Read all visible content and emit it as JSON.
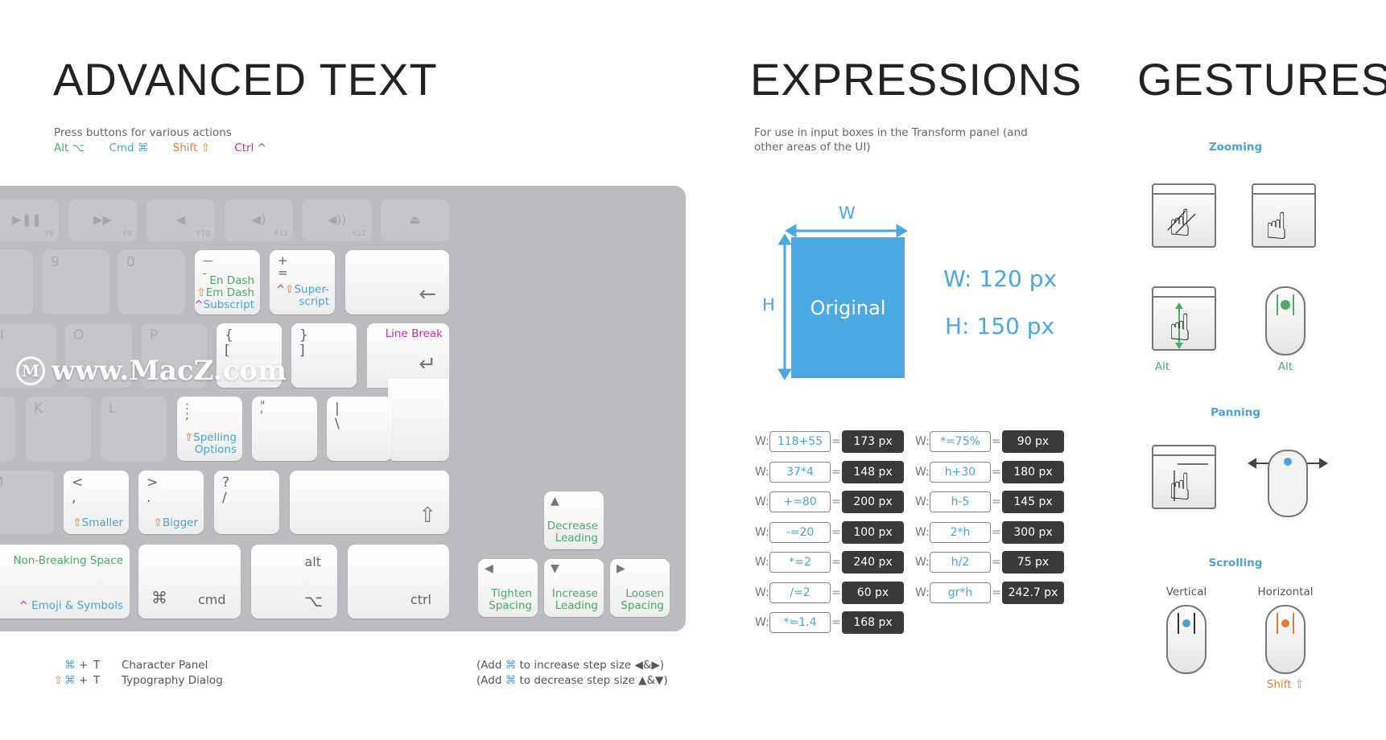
{
  "sections": {
    "advanced_text": {
      "title": "ADVANCED TEXT",
      "description": "Press buttons for various actions",
      "legend": {
        "alt": "Alt ⌥",
        "cmd": "Cmd ⌘",
        "shift": "Shift ⇧",
        "ctrl": "Ctrl ^"
      }
    },
    "expressions": {
      "title": "EXPRESSIONS",
      "description": "For use in input boxes in the Transform panel (and other areas of the UI)"
    },
    "gestures": {
      "title": "GESTURES"
    }
  },
  "keyboard": {
    "function_row": [
      {
        "icon": "play-pause-icon",
        "glyph": "▶❚❚",
        "fn": "F8"
      },
      {
        "icon": "fast-forward-icon",
        "glyph": "▶▶",
        "fn": "F9"
      },
      {
        "icon": "mute-icon",
        "glyph": "◀",
        "fn": "F10"
      },
      {
        "icon": "volume-down-icon",
        "glyph": "◀)",
        "fn": "F11"
      },
      {
        "icon": "volume-up-icon",
        "glyph": "◀))",
        "fn": "F12"
      },
      {
        "icon": "eject-icon",
        "glyph": "⏏",
        "fn": ""
      }
    ],
    "number_row": {
      "k9": "9",
      "k0": "0",
      "minus": {
        "top": "—",
        "base": "-",
        "a1": "En Dash",
        "a2_mod": "⇧",
        "a2": "Em Dash",
        "a3_mod": "^",
        "a3": "Subscript"
      },
      "equals": {
        "top": "+",
        "base": "=",
        "mod1": "^",
        "mod2": "⇧",
        "action": "Super-\nscript"
      },
      "backspace": "←"
    },
    "qwerty_row": {
      "i": "I",
      "o": "O",
      "p": "P",
      "lbracket": {
        "top": "{",
        "base": "["
      },
      "rbracket": {
        "top": "}",
        "base": "]"
      },
      "return": {
        "label": "Line Break",
        "glyph": "↵"
      }
    },
    "home_row": {
      "k": "K",
      "l": "L",
      "semicolon": {
        "top": ":",
        "base": ";",
        "mod": "⇧",
        "action": "Spelling\nOptions"
      },
      "quote": {
        "top": "\"",
        "base": "'"
      },
      "backslash": {
        "top": "|",
        "base": "\\"
      }
    },
    "bottom_row": {
      "m": "M",
      "comma": {
        "top": "<",
        "base": ",",
        "mod": "⇧",
        "action": "Smaller"
      },
      "period": {
        "top": ">",
        "base": ".",
        "mod": "⇧",
        "action": "Bigger"
      },
      "slash": {
        "top": "?",
        "base": "/"
      },
      "shift": "⇧"
    },
    "modifier_row": {
      "space": {
        "action": "Non-Breaking Space",
        "mod": "^",
        "action2": "Emoji & Symbols"
      },
      "cmd": {
        "glyph": "⌘",
        "label": "cmd"
      },
      "alt": {
        "label": "alt",
        "glyph": "⌥"
      },
      "ctrl": {
        "label": "ctrl"
      }
    },
    "arrows": {
      "up": {
        "glyph": "▲",
        "action": "Decrease\nLeading"
      },
      "left": {
        "glyph": "◀",
        "action": "Tighten\nSpacing"
      },
      "down": {
        "glyph": "▼",
        "action": "Increase\nLeading"
      },
      "right": {
        "glyph": "▶",
        "action": "Loosen\nSpacing"
      }
    }
  },
  "watermark": {
    "logo": "M",
    "text": "www.MacZ.com"
  },
  "shortcuts": [
    {
      "mods": "⌘",
      "plus": "+",
      "key": "T",
      "label": "Character Panel"
    },
    {
      "mods_shift": "⇧",
      "mods": "⌘",
      "plus": "+",
      "key": "T",
      "label": "Typography Dialog"
    }
  ],
  "step_notes": [
    {
      "pre": "(Add ",
      "mod": "⌘",
      "post": " to increase step size ◀&▶)"
    },
    {
      "pre": "(Add ",
      "mod": "⌘",
      "post": " to decrease step size ▲&▼)"
    }
  ],
  "transform_diagram": {
    "w_label": "W",
    "h_label": "H",
    "box_label": "Original",
    "width_readout": "W: 120 px",
    "height_readout": "H: 150 px"
  },
  "expressions_left": [
    {
      "field": "W:",
      "input": "118+55",
      "eq": "=",
      "result": "173 px"
    },
    {
      "field": "W:",
      "input": "37*4",
      "eq": "=",
      "result": "148 px"
    },
    {
      "field": "W:",
      "input": "+=80",
      "eq": "=",
      "result": "200 px"
    },
    {
      "field": "W:",
      "input": "-=20",
      "eq": "=",
      "result": "100 px"
    },
    {
      "field": "W:",
      "input": "*=2",
      "eq": "=",
      "result": "240 px"
    },
    {
      "field": "W:",
      "input": "/=2",
      "eq": "=",
      "result": "60 px"
    },
    {
      "field": "W:",
      "input": "*=1.4",
      "eq": "=",
      "result": "168 px"
    }
  ],
  "expressions_right": [
    {
      "field": "W:",
      "input": "*=75%",
      "eq": "=",
      "result": "90 px"
    },
    {
      "field": "W:",
      "input": "h+30",
      "eq": "=",
      "result": "180 px"
    },
    {
      "field": "W:",
      "input": "h-5",
      "eq": "=",
      "result": "145 px"
    },
    {
      "field": "W:",
      "input": "2*h",
      "eq": "=",
      "result": "300 px"
    },
    {
      "field": "W:",
      "input": "h/2",
      "eq": "=",
      "result": "75 px"
    },
    {
      "field": "W:",
      "input": "gr*h",
      "eq": "=",
      "result": "242.7 px"
    }
  ],
  "gestures": {
    "zooming": {
      "heading": "Zooming",
      "alt1": "Alt",
      "alt2": "Alt"
    },
    "panning": {
      "heading": "Panning"
    },
    "scrolling": {
      "heading": "Scrolling",
      "vertical": "Vertical",
      "horizontal": "Horizontal",
      "modifier": "Shift ⇧"
    }
  },
  "colors": {
    "alt": "#4caa6a",
    "cmd": "#4aa3d8",
    "shift": "#e07b3e",
    "ctrl": "#c0339a",
    "accent": "#4aa8e2",
    "keyboard": "#bbbcbf"
  }
}
